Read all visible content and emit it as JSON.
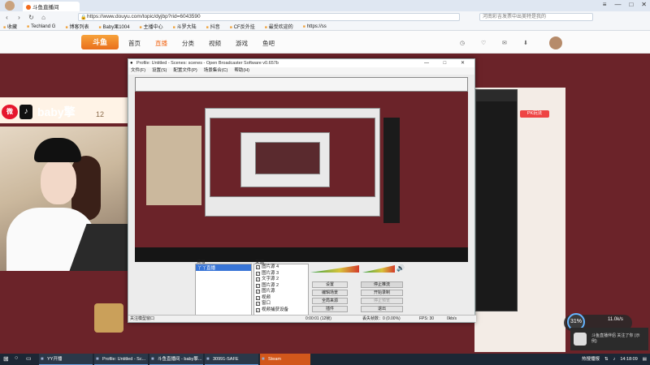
{
  "browser": {
    "tab_title": "斗鱼直播间",
    "url": "https://www.douyu.com/topic/dyjbp?rid=6043590",
    "search_placeholder": "河南彩吉发票中出美特是我的",
    "bookmarks": [
      "收藏",
      "Techland G",
      "博客列表",
      "Baby果1004",
      "主播中心",
      "斗罗大陆",
      "抖音",
      "CF反外挂",
      "最受欢迎的",
      "https://ss"
    ]
  },
  "site": {
    "logo": "斗鱼",
    "nav": [
      "首页",
      "直播",
      "分类",
      "视频",
      "游戏",
      "鱼吧"
    ],
    "active_nav": "直播"
  },
  "streamer": {
    "name": "baby擎",
    "count": "12"
  },
  "chat": {
    "pk_badge": "PK玩法",
    "messages": "…"
  },
  "obs": {
    "title": "Profile: Untitled - Scenes: scenes - Open Broadcaster Software v0.657b",
    "menu": [
      "文件(F)",
      "设置(S)",
      "配置文件(P)",
      "场景集合(C)",
      "帮助(H)"
    ],
    "scenes_label": "场景",
    "sources_label": "来源",
    "scenes": [
      "丫丫直播"
    ],
    "sources": [
      "图片源 4",
      "图片源 3",
      "文字源 2",
      "图片源 2",
      "图片源",
      "视频",
      "窗口",
      "视频捕获设备"
    ],
    "buttons": {
      "settings": "设置",
      "edit_scene": "编辑场景",
      "global_sources": "全局来源",
      "plugins": "插件",
      "stop_stream": "停止推流",
      "start_record": "开始录制",
      "stop_preview": "停止预览",
      "exit": "退出"
    },
    "status": {
      "left": "关注模型窗口",
      "time": "0:00:01 (12帧)",
      "dropped": "丢失帧数：0 (0.00%)",
      "fps": "FPS: 30",
      "bitrate": "0kb/s"
    },
    "colors": {
      "selected": "#3875d7",
      "meter_hi": "#d43b2b",
      "meter_lo": "#3ba34a"
    }
  },
  "overlay": {
    "volume_pct": "31%",
    "speed": "11.0k/s",
    "notification": "斗鱼直播伴侣 关注了你 (示例)"
  },
  "taskbar": {
    "items": [
      "YY开播",
      "Profile: Untitled - Sc...",
      "斗鱼直播间 - baby擎...",
      "30991-SAFE",
      "Steam"
    ],
    "time": "14:18:09",
    "tray_text": "热搜播报"
  }
}
